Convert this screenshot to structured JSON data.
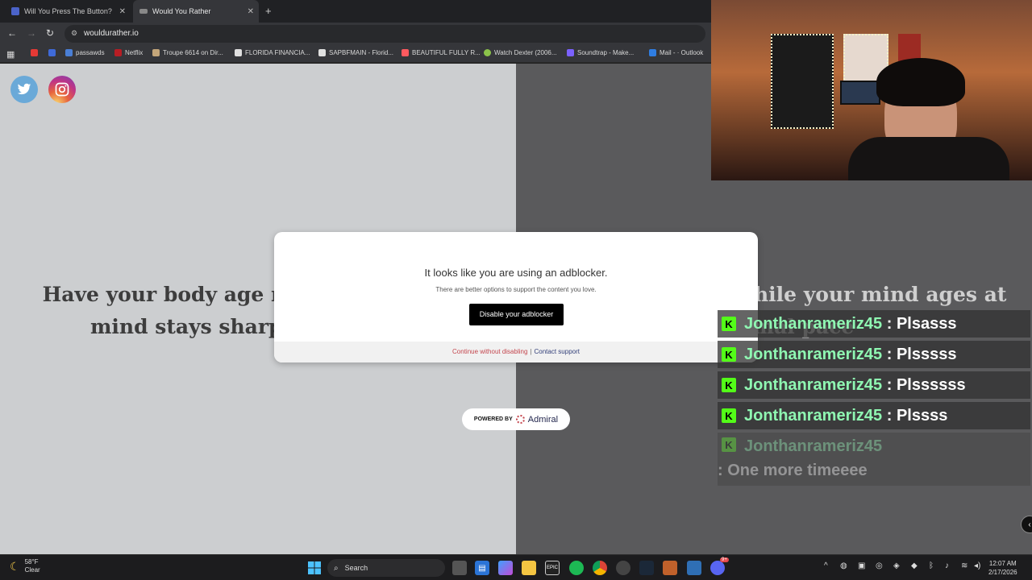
{
  "browser": {
    "tabs": [
      {
        "title": "Will You Press The Button?",
        "active": false
      },
      {
        "title": "Would You Rather",
        "active": true
      }
    ],
    "url": "wouldurather.io",
    "bookmarks": [
      {
        "label": "",
        "color": "#e53935"
      },
      {
        "label": "",
        "color": "#3f6ad8"
      },
      {
        "label": "passawds",
        "color": "#4a7fd6"
      },
      {
        "label": "Netflix",
        "color": "#b81d24"
      },
      {
        "label": "Troupe 6614 on Dir...",
        "color": "#c4a67a"
      },
      {
        "label": "FLORIDA FINANCIA...",
        "color": "#e0e0e0"
      },
      {
        "label": "SAPBFMAIN - Florid...",
        "color": "#e0e0e0"
      },
      {
        "label": "BEAUTIFUL FULLY R...",
        "color": "#ff5a5f"
      },
      {
        "label": "Watch Dexter (2006...",
        "color": "#8bc34a"
      },
      {
        "label": "Soundtrap - Make...",
        "color": "#7b61ff"
      },
      {
        "label": "Mail - · Outlook",
        "color": "#2f7de1"
      }
    ]
  },
  "page": {
    "question_left": "Have your body age normally but your mind stays sharp and focused",
    "question_right": "Remain youthful while your mind ages at a normal pace"
  },
  "modal": {
    "title": "It looks like you are using an adblocker.",
    "subtitle": "There are better options to support the content you love.",
    "button": "Disable your adblocker",
    "continue_link": "Continue without disabling",
    "separator": "|",
    "contact_link": "Contact support"
  },
  "powered": {
    "prefix": "POWERED BY",
    "brand": "Admiral"
  },
  "chat": [
    {
      "user": "Jonthanrameriz45",
      "message": " : Plsasss"
    },
    {
      "user": "Jonthanrameriz45",
      "message": " : Plsssss"
    },
    {
      "user": "Jonthanrameriz45",
      "message": " : Plssssss"
    },
    {
      "user": "Jonthanrameriz45",
      "message": " : Plssss"
    },
    {
      "user": "Jonthanrameriz45",
      "message": " : One more timeeee"
    }
  ],
  "taskbar": {
    "temperature": "58°F",
    "condition": "Clear",
    "search_placeholder": "Search",
    "time": "12:07 AM",
    "date": "2/17/2026",
    "discord_badge": "9+"
  }
}
